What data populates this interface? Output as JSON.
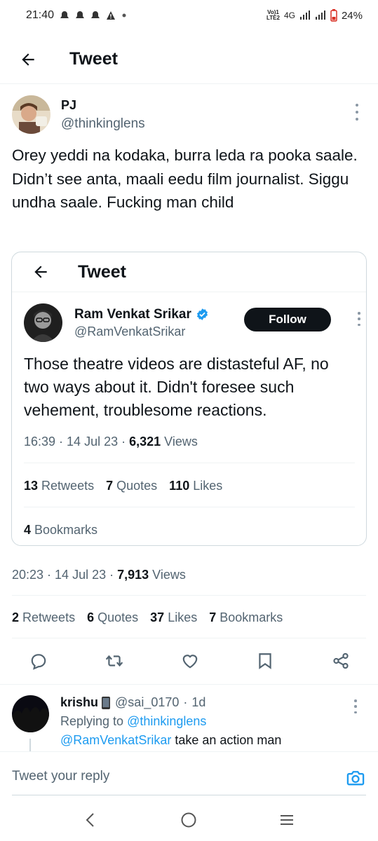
{
  "status_bar": {
    "time": "21:40",
    "network_top": "Vo)1",
    "network_bottom": "LTE2",
    "network_type": "4G",
    "battery": "24%"
  },
  "header": {
    "title": "Tweet",
    "back_icon": "arrow-left-icon"
  },
  "tweet": {
    "author_name": "PJ",
    "author_handle": "@thinkinglens",
    "text": "Orey yeddi na kodaka, burra leda ra pooka saale. Didn’t see anta, maali eedu film journalist. Siggu undha saale. Fucking man child",
    "time": "20:23",
    "date": "14 Jul 23",
    "views_count": "7,913",
    "views_label": "Views",
    "retweets_count": "2",
    "retweets_label": "Retweets",
    "quotes_count": "6",
    "quotes_label": "Quotes",
    "likes_count": "37",
    "likes_label": "Likes",
    "bookmarks_count": "7",
    "bookmarks_label": "Bookmarks"
  },
  "quoted": {
    "header_title": "Tweet",
    "author_name": "Ram Venkat Srikar",
    "author_handle": "@RamVenkatSrikar",
    "follow_label": "Follow",
    "text": "Those theatre videos are distasteful AF, no two ways about it. Didn't foresee such vehement, troublesome reactions.",
    "time": "16:39",
    "date": "14 Jul 23",
    "views_count": "6,321",
    "views_label": "Views",
    "retweets_count": "13",
    "retweets_label": "Retweets",
    "quotes_count": "7",
    "quotes_label": "Quotes",
    "likes_count": "110",
    "likes_label": "Likes",
    "bookmarks_count": "4",
    "bookmarks_label": "Bookmarks"
  },
  "actions": [
    "reply-icon",
    "retweet-icon",
    "like-icon",
    "bookmark-icon",
    "share-icon"
  ],
  "reply": {
    "author_name": "krishu",
    "author_handle": "@sai_0170",
    "age": "1d",
    "replying_prefix": "Replying to",
    "replying_to": "@thinkinglens",
    "mention": "@RamVenkatSrikar",
    "text": "take an action man"
  },
  "composer": {
    "placeholder": "Tweet your reply"
  },
  "colors": {
    "link": "#1d9bf0",
    "text_primary": "#0f1419",
    "text_secondary": "#536471",
    "verified": "#1d9bf0"
  }
}
